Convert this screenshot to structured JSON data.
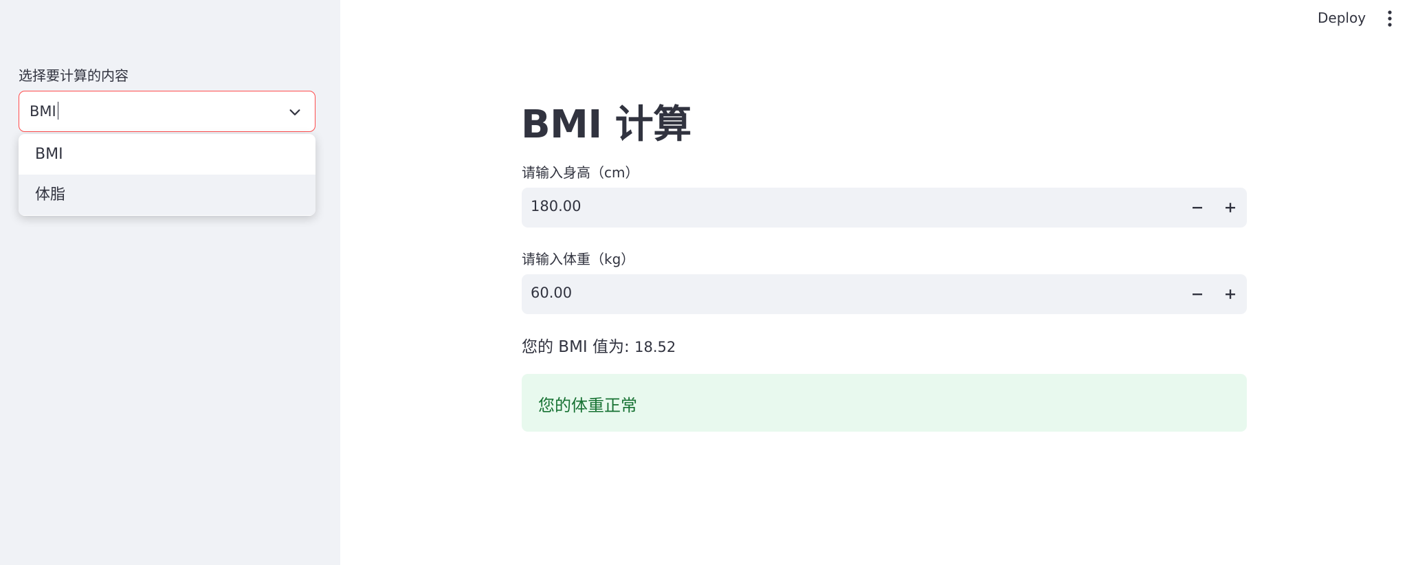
{
  "sidebar": {
    "select_label": "选择要计算的内容",
    "select_value": "BMI",
    "options": [
      "BMI",
      "体脂"
    ]
  },
  "header": {
    "deploy_label": "Deploy"
  },
  "main": {
    "title": "BMI 计算",
    "height_label": "请输入身高（cm）",
    "height_value": "180.00",
    "weight_label": "请输入体重（kg）",
    "weight_value": "60.00",
    "result_prefix": "您的 BMI 值为:",
    "result_value": "18.52",
    "status_message": "您的体重正常"
  },
  "icons": {
    "select_toggle": "chevron-down-icon",
    "menu": "kebab-menu-icon",
    "decrement": "minus-icon",
    "increment": "plus-icon"
  },
  "colors": {
    "sidebar_bg": "#f0f2f6",
    "focus_border": "#ff4b4b",
    "input_bg": "#f0f2f6",
    "success_bg": "#e8f9ee",
    "success_text": "#177233",
    "text": "#31333f"
  }
}
